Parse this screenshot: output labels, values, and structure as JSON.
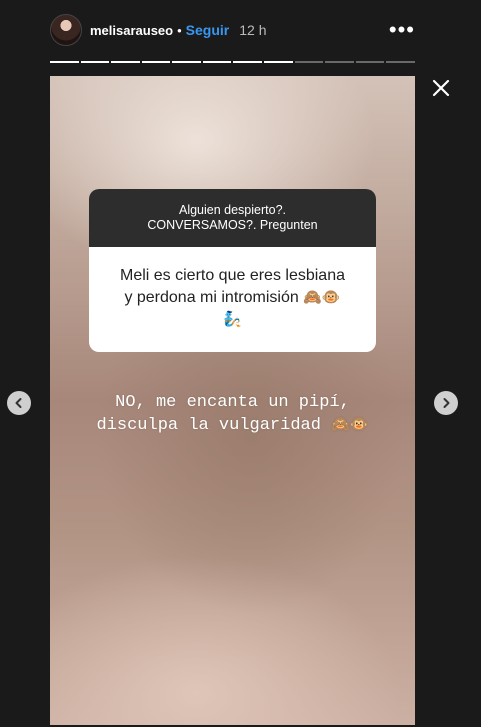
{
  "header": {
    "username": "melisarauseo",
    "separator": "•",
    "follow_label": "Seguir",
    "time_ago": "12 h",
    "more_label": "•••"
  },
  "progress": {
    "segments_total": 12,
    "segments_viewed": 8
  },
  "question_sticker": {
    "prompt_line1": "Alguien despierto?.",
    "prompt_line2": "CONVERSAMOS?. Pregunten",
    "question_line1": "Meli es cierto que eres lesbiana",
    "question_line2": "y perdona mi intromisión",
    "question_emoji1": "🙈🐵",
    "question_emoji2": "🧞"
  },
  "answer": {
    "line1": "NO, me encanta un pipí,",
    "line2": "disculpa la vulgaridad",
    "emoji": "🙈🐵"
  },
  "colors": {
    "background": "#1a1a1a",
    "follow_accent": "#3897f0",
    "sticker_header": "#2d2d2d"
  },
  "icons": {
    "close": "close-icon",
    "prev": "chevron-left-icon",
    "next": "chevron-right-icon",
    "more": "more-horizontal-icon"
  }
}
